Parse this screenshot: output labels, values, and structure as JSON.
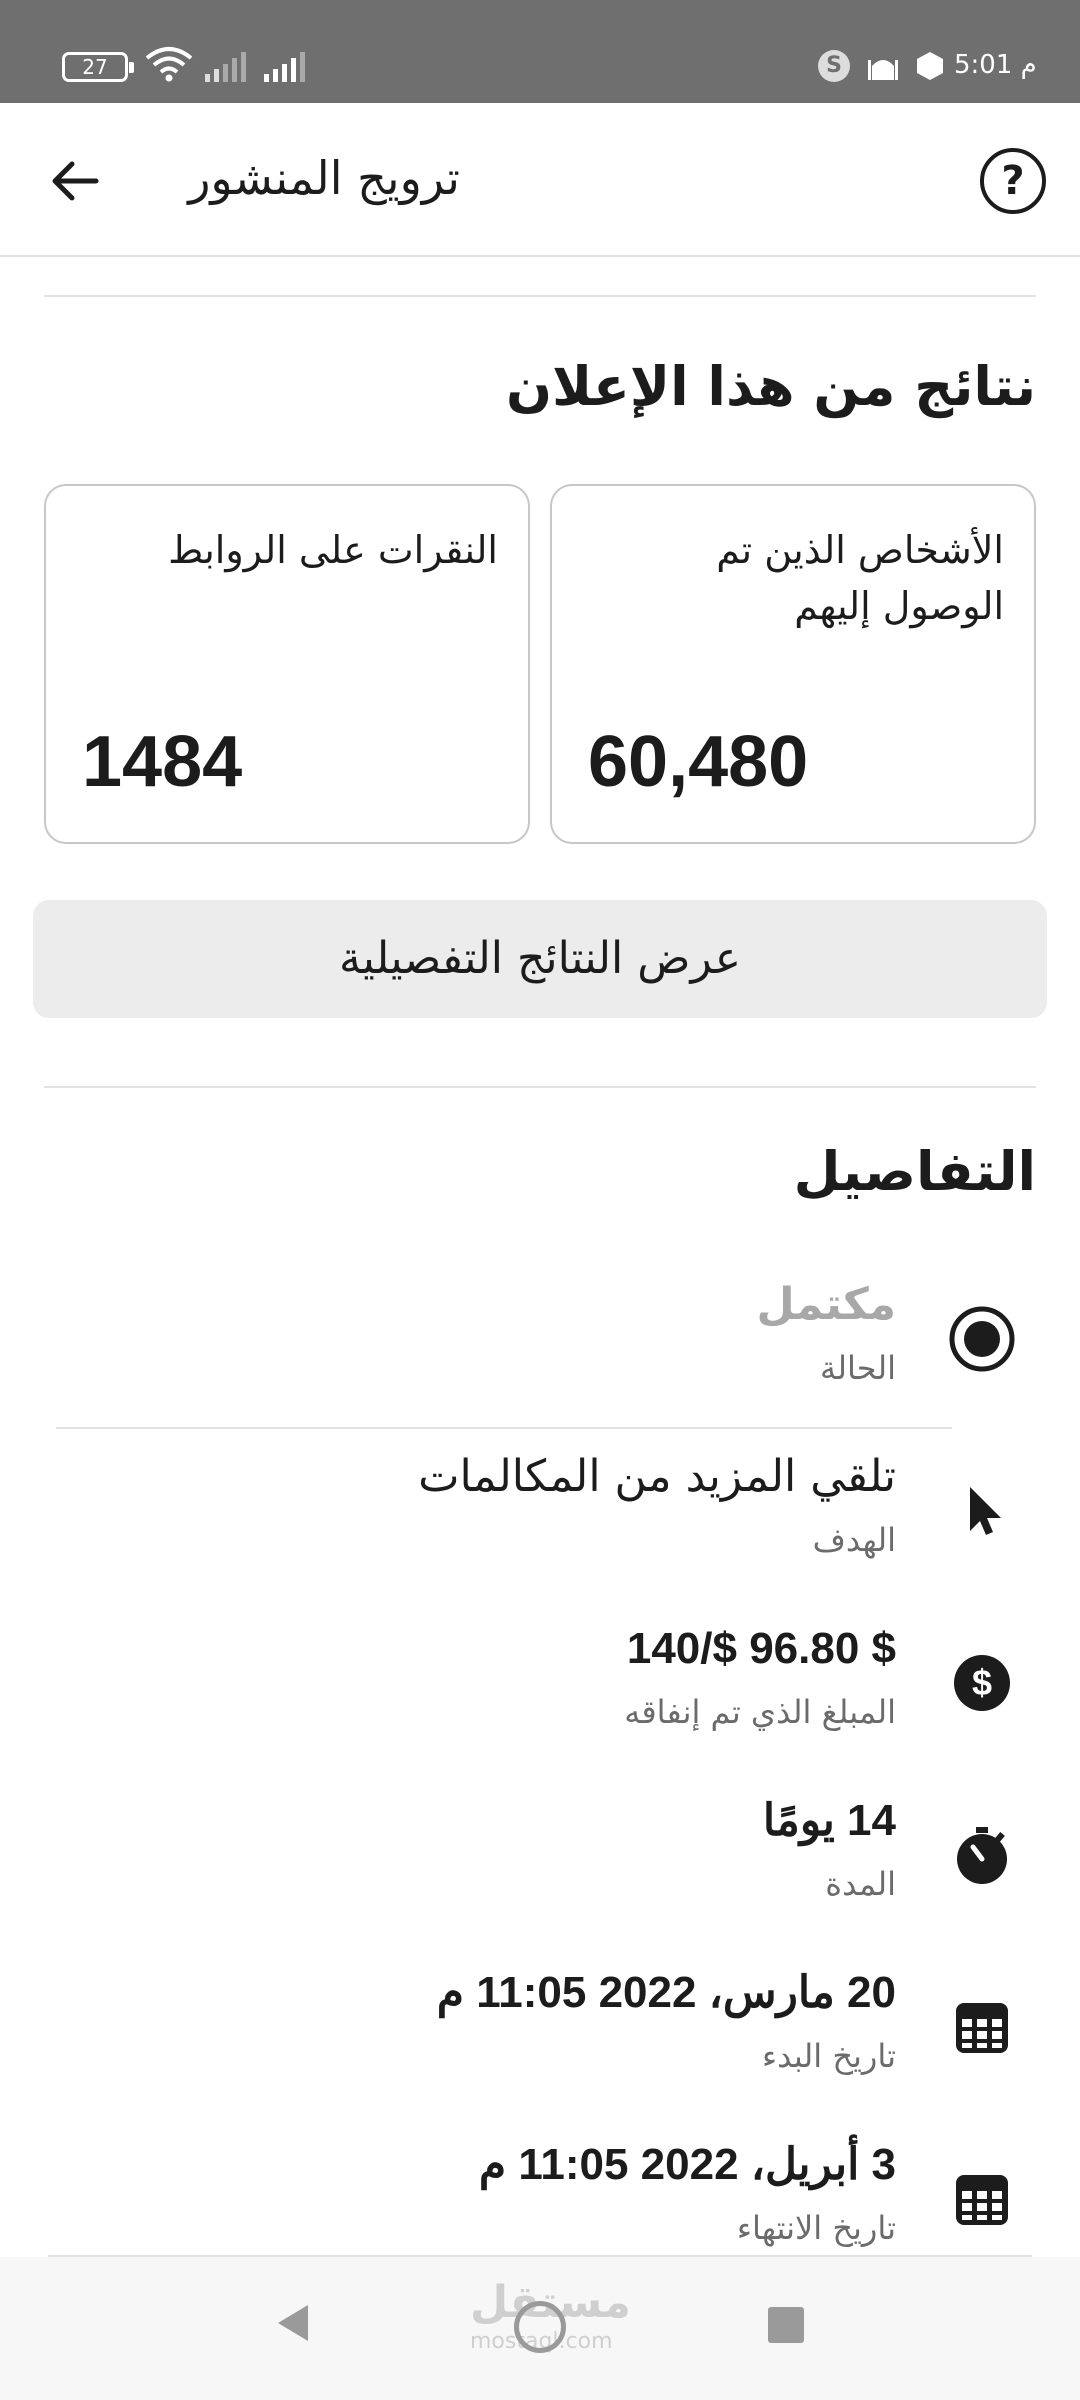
{
  "status_bar": {
    "battery": "27",
    "time": "5:01 م",
    "skype_letter": "S",
    "icons": [
      "battery-icon",
      "wifi-icon",
      "signal-icon",
      "signal-icon",
      "skype-icon",
      "mosque-icon",
      "hexagon-icon"
    ]
  },
  "header": {
    "title": "ترويج المنشور",
    "help_symbol": "?",
    "icons": [
      "help-icon",
      "back-arrow-icon"
    ]
  },
  "results": {
    "title": "نتائج من هذا الإعلان",
    "reach": {
      "label": "الأشخاص الذين تم الوصول إليهم",
      "value": "60,480"
    },
    "clicks": {
      "label": "النقرات على الروابط",
      "value": "1484"
    },
    "detail_button": "عرض النتائج التفصيلية"
  },
  "details": {
    "title": "التفاصيل",
    "rows": [
      {
        "value": "مكتمل",
        "label": "الحالة",
        "icon": "radio-status-icon"
      },
      {
        "value": "تلقي المزيد من المكالمات",
        "label": "الهدف",
        "icon": "cursor-icon"
      },
      {
        "value": "$ 96.80 $/140",
        "label": "المبلغ الذي تم إنفاقه",
        "icon": "dollar-icon"
      },
      {
        "value": "14 يومًا",
        "label": "المدة",
        "icon": "stopwatch-icon"
      },
      {
        "value": "20 مارس، 2022 11:05 م",
        "label": "تاريخ البدء",
        "icon": "calendar-icon"
      },
      {
        "value": "3 أبريل، 2022 11:05 م",
        "label": "تاريخ الانتهاء",
        "icon": "calendar-icon"
      }
    ]
  },
  "watermark": {
    "arabic": "مستقل",
    "latin": "mostaql.com"
  },
  "nav": {
    "icons": [
      "nav-back-icon",
      "nav-home-icon",
      "nav-recent-icon"
    ]
  },
  "colors": {
    "status_bar_bg": "#6f6f6f",
    "muted_status": "#a8a8a8",
    "button_bg": "#ececec",
    "card_border": "#c7c7c7"
  }
}
